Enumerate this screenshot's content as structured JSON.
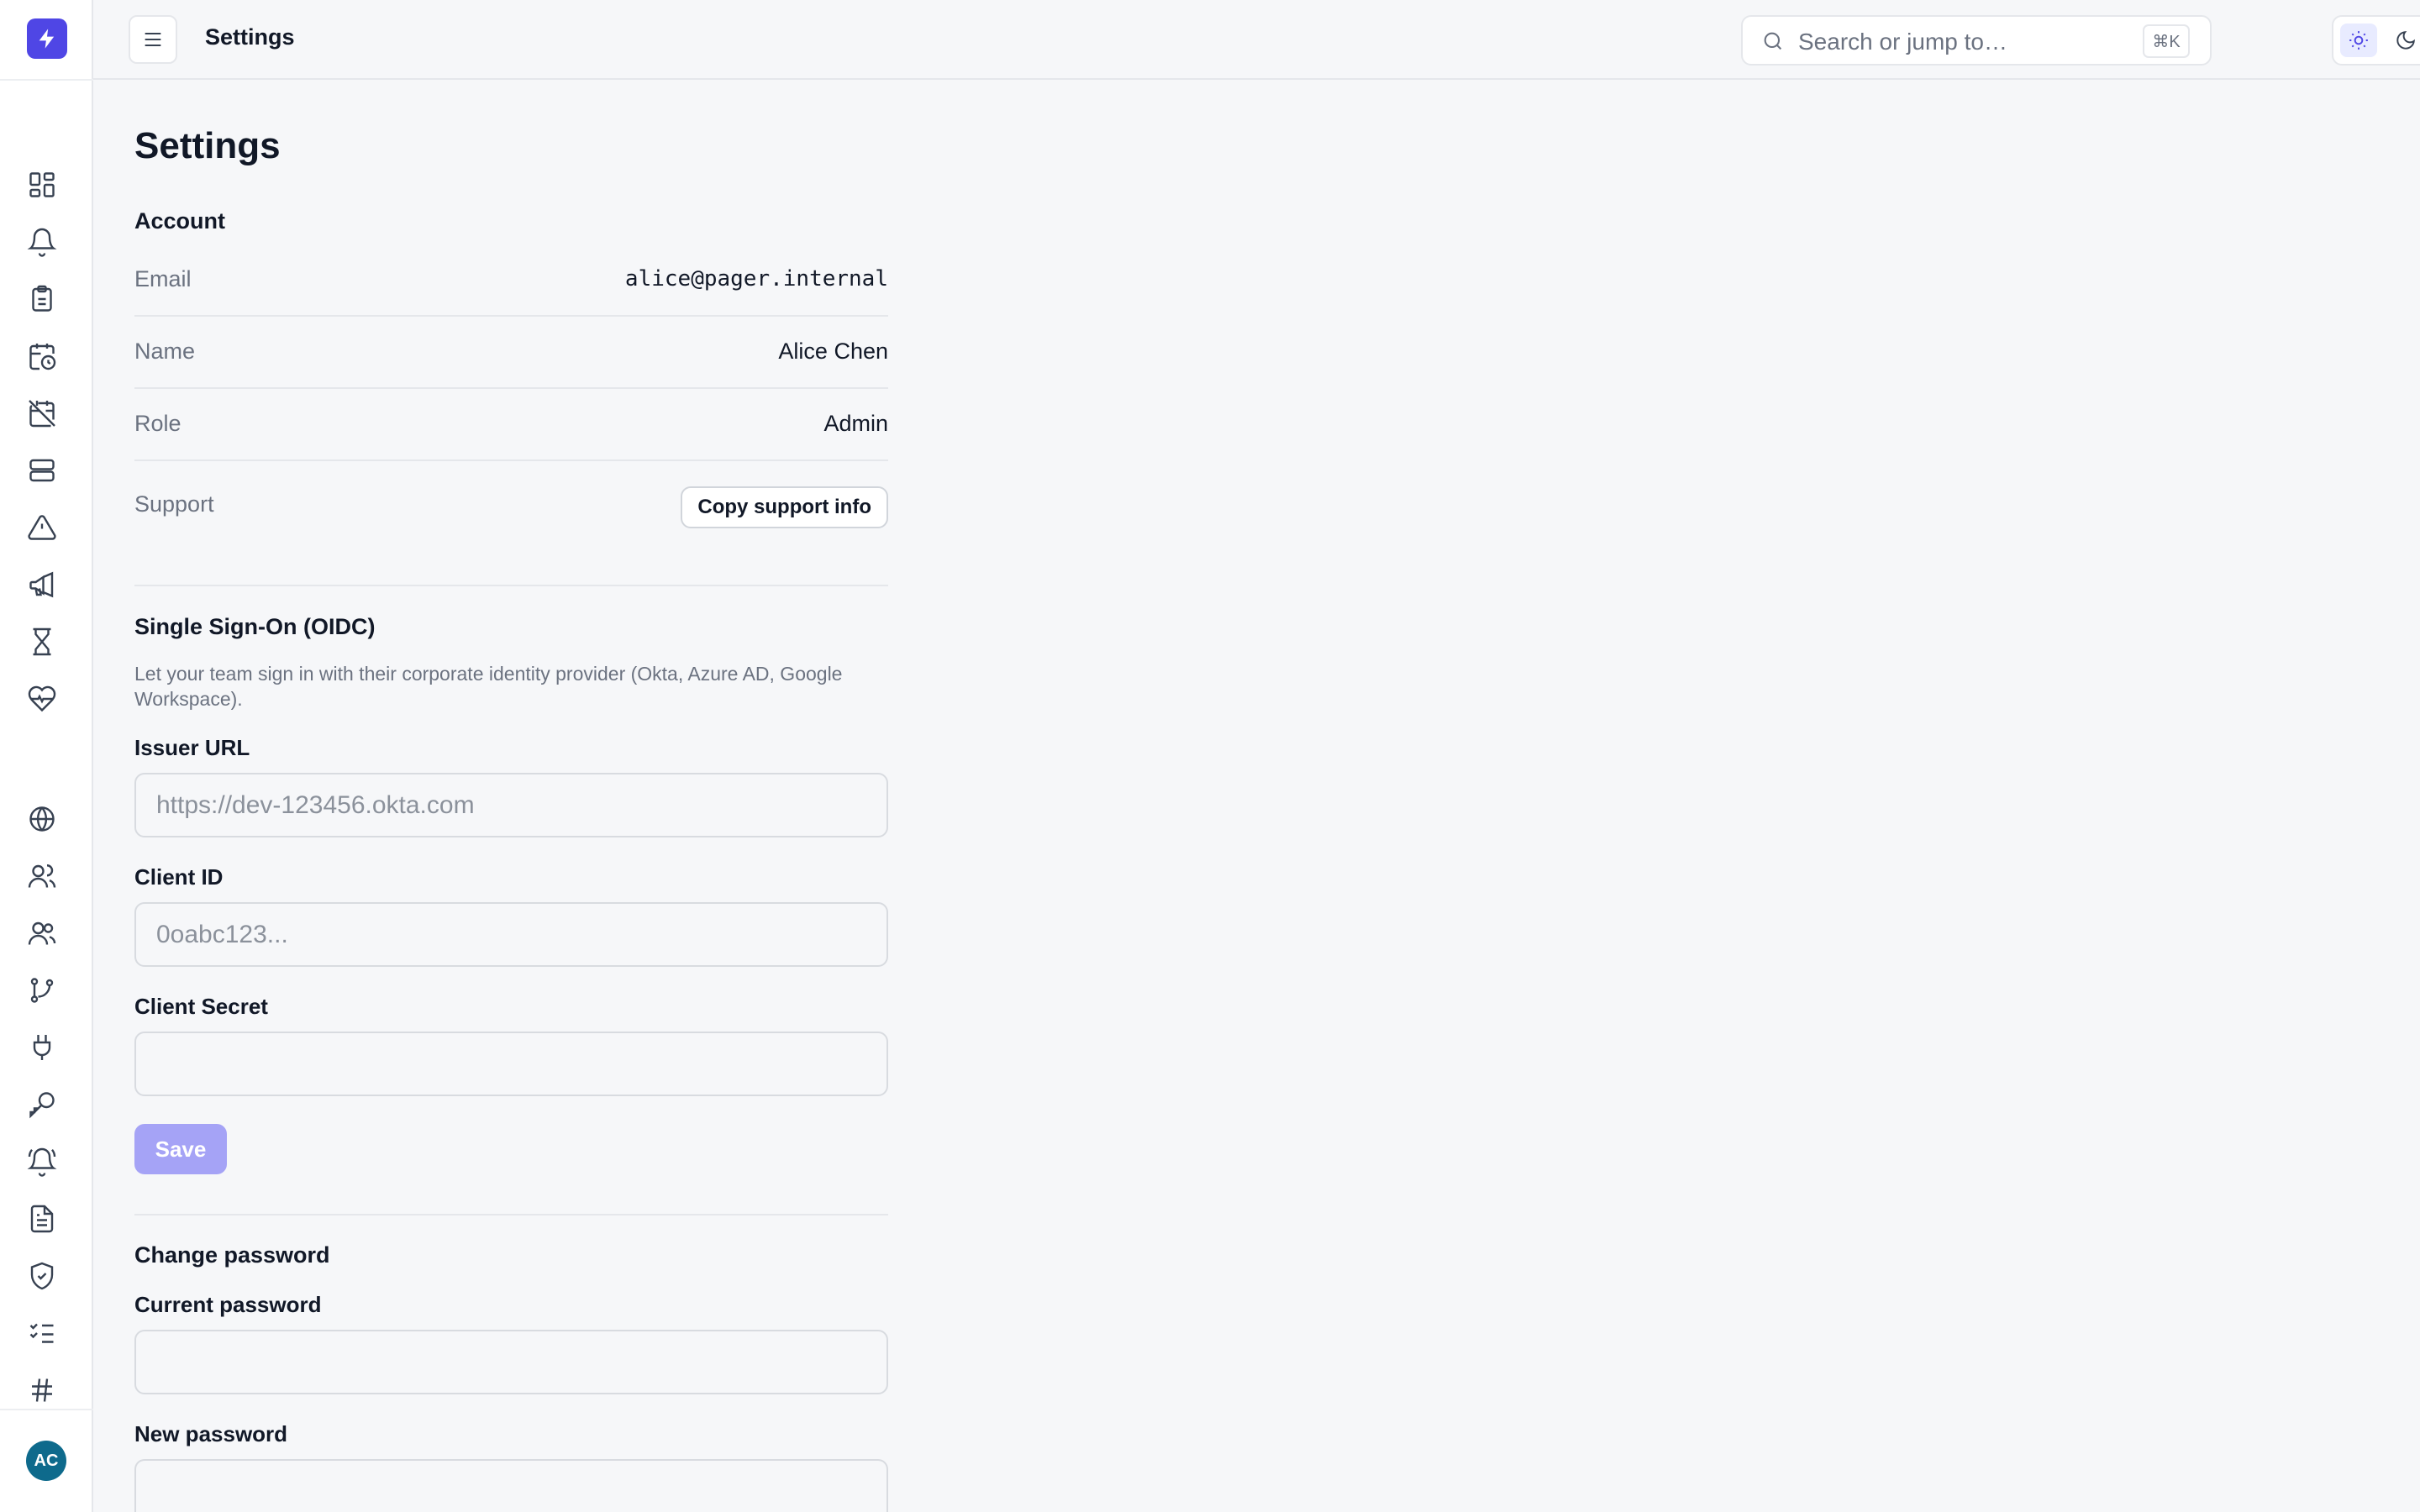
{
  "topbar": {
    "title": "Settings",
    "search_placeholder": "Search or jump to…",
    "search_shortcut": "⌘K"
  },
  "sidebar": {
    "avatar_initials": "AC",
    "icons": [
      "dashboard-icon",
      "bell-icon",
      "clipboard-icon",
      "calendar-clock-icon",
      "calendar-off-icon",
      "server-icon",
      "alert-triangle-icon",
      "megaphone-icon",
      "hourglass-icon",
      "heart-pulse-icon",
      "globe-icon",
      "user-icon",
      "users-icon",
      "git-branch-icon",
      "plug-icon",
      "key-icon",
      "bell-ring-icon",
      "file-text-icon",
      "shield-check-icon",
      "list-checks-icon",
      "hash-icon"
    ]
  },
  "page": {
    "title": "Settings",
    "account": {
      "heading": "Account",
      "email_label": "Email",
      "email_value": "alice@pager.internal",
      "name_label": "Name",
      "name_value": "Alice Chen",
      "role_label": "Role",
      "role_value": "Admin",
      "support_label": "Support",
      "support_button": "Copy support info"
    },
    "sso": {
      "heading": "Single Sign-On (OIDC)",
      "description": "Let your team sign in with their corporate identity provider (Okta, Azure AD, Google Workspace).",
      "issuer_label": "Issuer URL",
      "issuer_placeholder": "https://dev-123456.okta.com",
      "client_id_label": "Client ID",
      "client_id_placeholder": "0oabc123...",
      "client_secret_label": "Client Secret",
      "save_button": "Save"
    },
    "password": {
      "heading": "Change password",
      "current_label": "Current password",
      "new_label": "New password"
    }
  },
  "colors": {
    "accent": "#4f46e5",
    "save_disabled": "#a5a3f6",
    "avatar": "#0e6a8c"
  }
}
